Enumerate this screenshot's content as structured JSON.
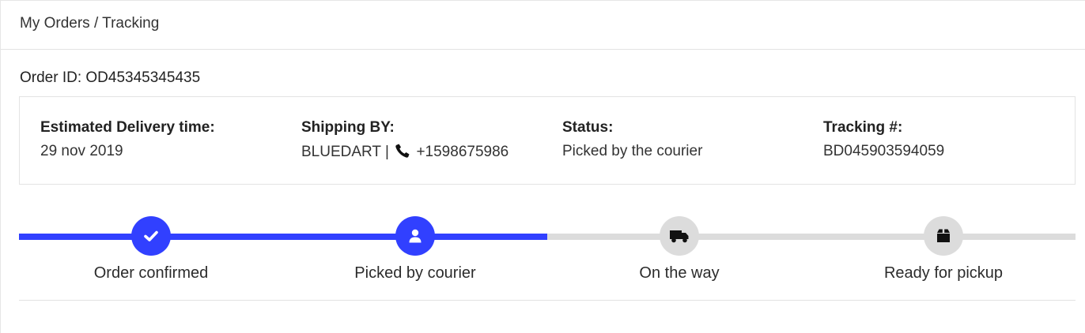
{
  "header": {
    "breadcrumb": "My Orders / Tracking"
  },
  "order": {
    "id_text": "Order ID: OD45345345435"
  },
  "info": {
    "delivery": {
      "label": "Estimated Delivery time:",
      "value": "29 nov 2019"
    },
    "shipping": {
      "label": "Shipping BY:",
      "carrier": "BLUEDART |",
      "phone": "+1598675986"
    },
    "status": {
      "label": "Status:",
      "value": "Picked by the courier"
    },
    "tracking": {
      "label": "Tracking #:",
      "value": "BD045903594059"
    }
  },
  "progress": {
    "completed_fraction": 0.5,
    "steps": [
      {
        "label": "Order confirmed",
        "icon": "check-icon",
        "done": true
      },
      {
        "label": "Picked by courier",
        "icon": "user-icon",
        "done": true
      },
      {
        "label": "On the way",
        "icon": "truck-icon",
        "done": false
      },
      {
        "label": "Ready for pickup",
        "icon": "box-icon",
        "done": false
      }
    ]
  },
  "colors": {
    "accent": "#3140ff",
    "inactive": "#dcdcdc"
  }
}
